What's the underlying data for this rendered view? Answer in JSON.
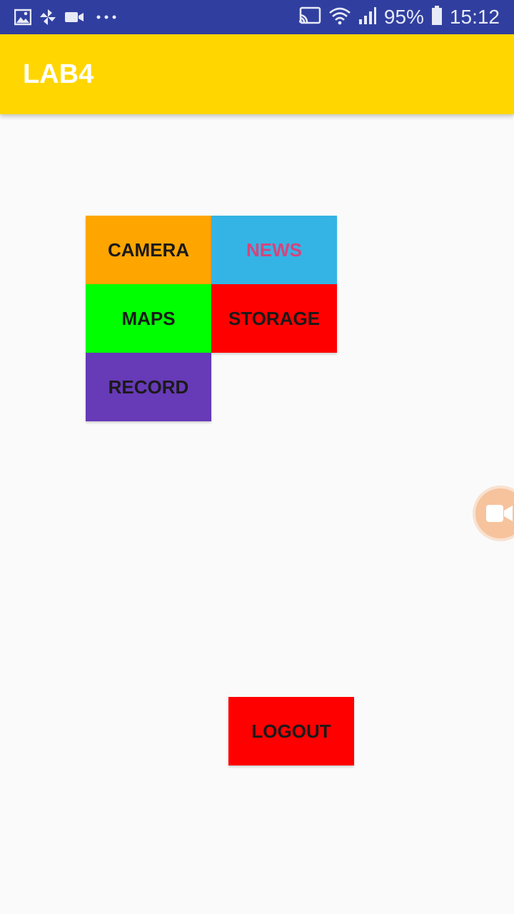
{
  "status_bar": {
    "left_icons": [
      "image-icon",
      "pinwheel-icon",
      "video-icon",
      "more-dots-icon"
    ],
    "cast_icon": "cast-icon",
    "wifi_icon": "wifi-icon",
    "signal_icon": "signal-icon",
    "battery_percent": "95%",
    "battery_icon": "battery-icon",
    "time": "15:12"
  },
  "app_bar": {
    "title": "LAB4",
    "color": "#ffd600"
  },
  "tiles": [
    {
      "label": "CAMERA",
      "bg": "#ffa500",
      "fg": "#1a1a1a"
    },
    {
      "label": "NEWS",
      "bg": "#34b4e4",
      "fg": "#d8437c"
    },
    {
      "label": "MAPS",
      "bg": "#00ff00",
      "fg": "#1a1a1a"
    },
    {
      "label": "STORAGE",
      "bg": "#ff0000",
      "fg": "#1a1a1a"
    },
    {
      "label": "RECORD",
      "bg": "#673ab7",
      "fg": "#1a1a1a"
    }
  ],
  "logout": {
    "label": "LOGOUT",
    "bg": "#ff0000",
    "fg": "#1a1a1a"
  },
  "floating_button": {
    "icon": "video-camera-icon",
    "color": "#f6c39d"
  }
}
